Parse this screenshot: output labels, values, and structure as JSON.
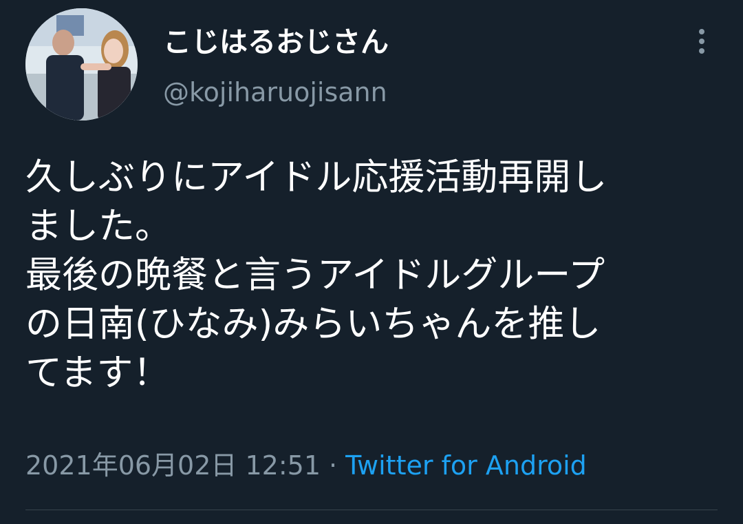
{
  "tweet": {
    "display_name": "こじはるおじさん",
    "handle": "@kojiharuojisann",
    "avatar_icon": "user-avatar-photo",
    "more_icon": "more-vertical-icon",
    "text": "久しぶりにアイドル応援活動再開し\nました。\n最後の晩餐と言うアイドルグループ\nの日南(ひなみ)みらいちゃんを推し\nてます！",
    "timestamp": "2021年06月02日 12:51",
    "separator": "·",
    "source": "Twitter for Android"
  },
  "colors": {
    "background": "#15202b",
    "primary_text": "#ffffff",
    "secondary_text": "#8899a6",
    "link": "#1da1f2",
    "divider": "#38444d"
  }
}
